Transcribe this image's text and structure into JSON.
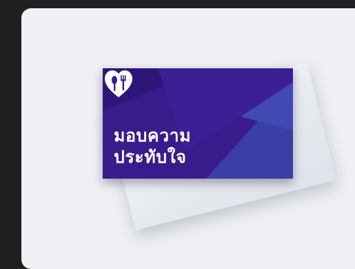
{
  "card": {
    "title_line_1": "มอบความ",
    "title_line_2": "ประทับใจ",
    "logo_icon": "heart-with-fork-and-spoon-icon",
    "colors": {
      "card_base": "#3a1b8c",
      "card_stripe_dark": "#2e157a",
      "card_stripe_light": "#3b3fa8",
      "text": "#ffffff",
      "envelope": "#eceef2"
    }
  },
  "background": {
    "outer": "#1f1f21",
    "panel": "#eef0f3"
  }
}
